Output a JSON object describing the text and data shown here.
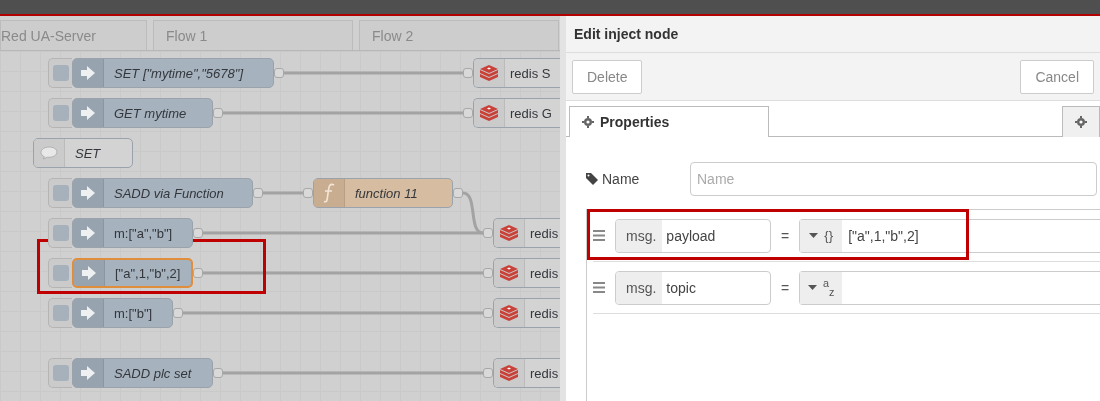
{
  "flow_tabs": [
    {
      "label": "Red UA-Server",
      "selected": false
    },
    {
      "label": "Flow 1",
      "selected": false
    },
    {
      "label": "Flow 2",
      "selected": false
    }
  ],
  "nodes": [
    {
      "kind": "inject",
      "label": "SET [\"mytime\",\"5678\"]",
      "named": true,
      "selected": false,
      "highlighted": false
    },
    {
      "kind": "inject",
      "label": "GET mytime",
      "named": true,
      "selected": false,
      "highlighted": false
    },
    {
      "kind": "comment",
      "label": "SET",
      "named": true,
      "selected": false,
      "highlighted": false
    },
    {
      "kind": "inject",
      "label": "SADD via Function",
      "named": true,
      "selected": false,
      "highlighted": false
    },
    {
      "kind": "function",
      "label": "function 11",
      "named": true,
      "selected": false,
      "highlighted": false
    },
    {
      "kind": "inject",
      "label": "m:[\"a\",\"b\"]",
      "named": false,
      "selected": false,
      "highlighted": false
    },
    {
      "kind": "inject",
      "label": "[\"a\",1,\"b\",2]",
      "named": false,
      "selected": true,
      "highlighted": true
    },
    {
      "kind": "inject",
      "label": "m:[\"b\"]",
      "named": false,
      "selected": false,
      "highlighted": false
    },
    {
      "kind": "inject",
      "label": "SADD plc set",
      "named": true,
      "selected": false,
      "highlighted": false
    },
    {
      "kind": "redis",
      "label": "redis S",
      "named": false,
      "selected": false,
      "highlighted": false
    },
    {
      "kind": "redis",
      "label": "redis G",
      "named": false,
      "selected": false,
      "highlighted": false
    },
    {
      "kind": "redis",
      "label": "redis",
      "named": false,
      "selected": false,
      "highlighted": false
    },
    {
      "kind": "redis",
      "label": "redis",
      "named": false,
      "selected": false,
      "highlighted": false
    },
    {
      "kind": "redis",
      "label": "redis",
      "named": false,
      "selected": false,
      "highlighted": false
    },
    {
      "kind": "redis",
      "label": "redis",
      "named": false,
      "selected": false,
      "highlighted": false
    }
  ],
  "editor": {
    "title": "Edit inject node",
    "delete_button": "Delete",
    "cancel_button": "Cancel",
    "tabs": [
      {
        "label": "Properties",
        "selected": true
      },
      {
        "selected": false
      }
    ],
    "name_label": "Name",
    "name_field": {
      "placeholder": "Name"
    },
    "properties": [
      {
        "prefix": "msg.",
        "property": "payload",
        "operator": "=",
        "type_icon": "{}",
        "value": "[\"a\",1,\"b\",2]",
        "highlighted": true
      },
      {
        "prefix": "msg.",
        "property": "topic",
        "operator": "=",
        "type_icon": "$^{a}$$_{z}$",
        "highlighted": false
      }
    ]
  }
}
